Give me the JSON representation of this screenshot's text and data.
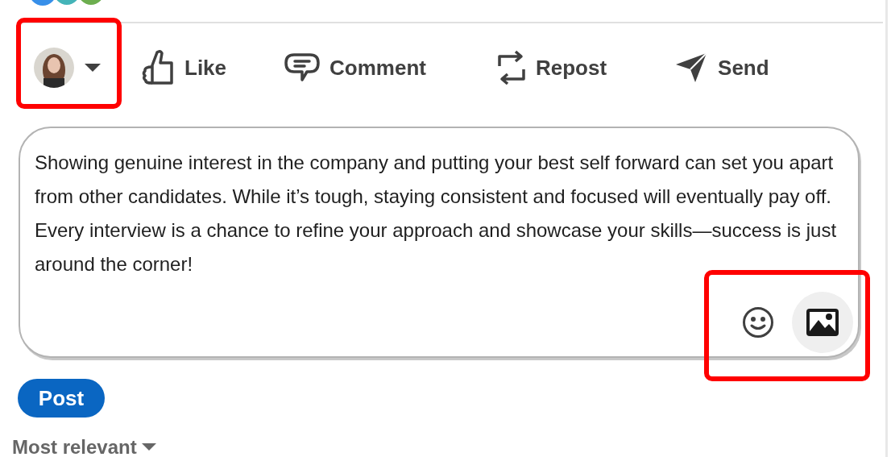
{
  "actor_menu": {
    "kind": "avatar-dropdown"
  },
  "actions": [
    {
      "kind": "like",
      "label": "Like"
    },
    {
      "kind": "comment",
      "label": "Comment"
    },
    {
      "kind": "repost",
      "label": "Repost"
    },
    {
      "kind": "send",
      "label": "Send"
    }
  ],
  "comment_box": {
    "value": "Showing genuine interest in the company and putting your best self forward can set you apart from other candidates. While it’s tough, staying consistent and focused will eventually pay off. Every interview is a chance to refine your approach and showcase your skills—success is just around the corner!",
    "tools": [
      {
        "kind": "emoji",
        "selected": false
      },
      {
        "kind": "image",
        "selected": true
      }
    ]
  },
  "submit_button": "Post",
  "sort_menu": "Most relevant"
}
